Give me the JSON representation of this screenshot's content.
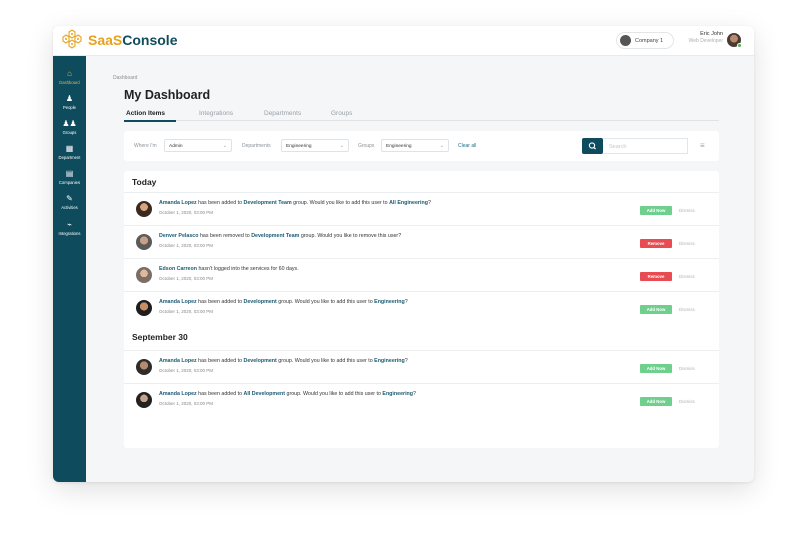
{
  "brand": {
    "name_part1": "SaaS",
    "name_part2": "Console",
    "color_primary": "#0d4b5d",
    "color_accent": "#e8a11c"
  },
  "header": {
    "company": "Company 1",
    "user_name": "Eric John",
    "user_role": "Web Developer"
  },
  "sidebar": {
    "items": [
      {
        "label": "Dashboard",
        "icon": "home-icon",
        "glyph": "⌂",
        "active": true
      },
      {
        "label": "People",
        "icon": "person-icon",
        "glyph": "♟",
        "active": false
      },
      {
        "label": "Groups",
        "icon": "group-icon",
        "glyph": "♟♟",
        "active": false
      },
      {
        "label": "Department",
        "icon": "building-icon",
        "glyph": "▦",
        "active": false
      },
      {
        "label": "Companies",
        "icon": "office-icon",
        "glyph": "▤",
        "active": false
      },
      {
        "label": "Activities",
        "icon": "pin-icon",
        "glyph": "✎",
        "active": false
      },
      {
        "label": "Integrations",
        "icon": "plug-icon",
        "glyph": "⌁",
        "active": false
      }
    ]
  },
  "breadcrumb": "Dashboard",
  "page_title": "My Dashboard",
  "tabs": [
    "Action Items",
    "Integrations",
    "Departments",
    "Groups"
  ],
  "filters": {
    "where_label": "Where I'm",
    "where_value": "Admin",
    "departments_label": "Departments",
    "departments_value": "Engineering",
    "groups_label": "Groups",
    "groups_value": "Engineering",
    "clear_all": "Clear all",
    "search_placeholder": "Search"
  },
  "sections": [
    {
      "title": "Today"
    },
    {
      "title": "September 30"
    }
  ],
  "actions": [
    {
      "date": "October 1, 2020, 03:00 PM",
      "parts": [
        {
          "t": "Amanda Lopez",
          "b": true
        },
        {
          "t": " has been added to "
        },
        {
          "t": "Development Team",
          "b": true
        },
        {
          "t": " group. Would you like to add this user to "
        },
        {
          "t": "All Engineering",
          "b": true
        },
        {
          "t": "?"
        }
      ],
      "button": "Add Now",
      "button_type": "add",
      "dismiss": "Dismiss"
    },
    {
      "date": "October 1, 2020, 03:00 PM",
      "parts": [
        {
          "t": "Denver Pelasco",
          "b": true
        },
        {
          "t": " has been removed to "
        },
        {
          "t": "Development Team",
          "b": true
        },
        {
          "t": " group. Would you like to remove this user?"
        }
      ],
      "button": "Remove",
      "button_type": "remove",
      "dismiss": "Dismiss"
    },
    {
      "date": "October 1, 2020, 03:00 PM",
      "parts": [
        {
          "t": "Edson Carreon",
          "b": true
        },
        {
          "t": " hasn't logged into the services for 60 days."
        }
      ],
      "button": "Remove",
      "button_type": "remove",
      "dismiss": "Dismiss"
    },
    {
      "date": "October 1, 2020, 03:00 PM",
      "parts": [
        {
          "t": "Amanda Lopez",
          "b": true
        },
        {
          "t": " has been added to "
        },
        {
          "t": "Development",
          "b": true
        },
        {
          "t": " group. Would you like to add this user to "
        },
        {
          "t": "Engineering",
          "b": true
        },
        {
          "t": "?"
        }
      ],
      "button": "Add Now",
      "button_type": "add",
      "dismiss": "Dismiss"
    },
    {
      "date": "October 1, 2020, 03:00 PM",
      "parts": [
        {
          "t": "Amanda Lopez",
          "b": true
        },
        {
          "t": " has been added to "
        },
        {
          "t": "Development",
          "b": true
        },
        {
          "t": " group. Would you like to add this user to "
        },
        {
          "t": "Engineering",
          "b": true
        },
        {
          "t": "?"
        }
      ],
      "button": "Add Now",
      "button_type": "add",
      "dismiss": "Dismiss"
    },
    {
      "date": "October 1, 2020, 03:00 PM",
      "parts": [
        {
          "t": "Amanda Lopez",
          "b": true
        },
        {
          "t": " has been added to "
        },
        {
          "t": "All Development",
          "b": true
        },
        {
          "t": " group. Would you like to add this user to "
        },
        {
          "t": "Engineering",
          "b": true
        },
        {
          "t": "?"
        }
      ],
      "button": "Add Now",
      "button_type": "add",
      "dismiss": "Dismiss"
    }
  ]
}
